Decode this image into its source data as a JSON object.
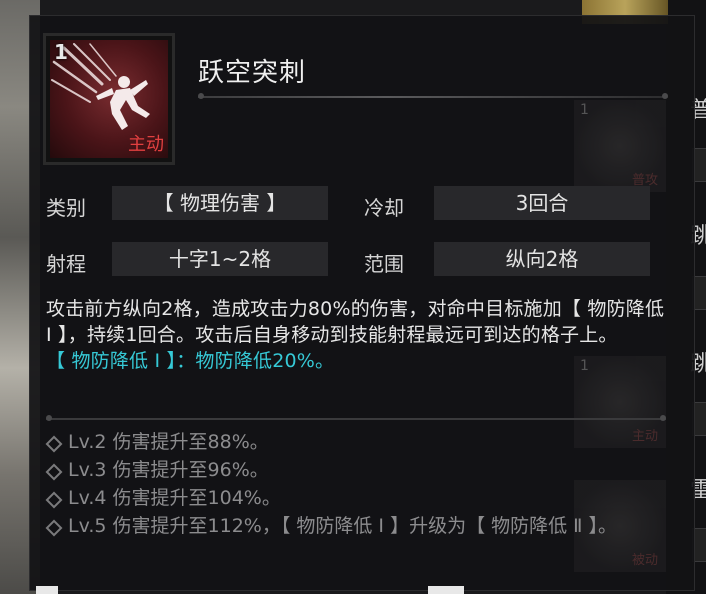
{
  "skill": {
    "level": "1",
    "type_badge": "主动",
    "name": "跃空突刺",
    "icon": "leaping-pierce-icon"
  },
  "attributes": [
    {
      "label": "类别",
      "value": "【 物理伤害 】"
    },
    {
      "label": "冷却",
      "value": "3回合"
    },
    {
      "label": "射程",
      "value": "十字1~2格"
    },
    {
      "label": "范围",
      "value": "纵向2格"
    }
  ],
  "description": {
    "main": "攻击前方纵向2格，造成攻击力80%的伤害，对命中目标施加【 物防降低 Ⅰ 】，持续1回合。攻击后自身移动到技能射程最远可到达的格子上。",
    "effect_note": "【 物防降低 Ⅰ 】：物防降低20%。"
  },
  "upgrades": [
    "Lv.2 伤害提升至88%。",
    "Lv.3 伤害提升至96%。",
    "Lv.4 伤害提升至104%。",
    "Lv.5 伤害提升至112%，【 物防降低 Ⅰ 】升级为【 物防降低 Ⅱ 】。"
  ],
  "background_cards": [
    {
      "level": "1",
      "label": "普攻"
    },
    {
      "level": "1",
      "label": "主动"
    },
    {
      "level": "",
      "label": "被动"
    }
  ],
  "side_tabs": [
    "普",
    "跳",
    "跳",
    "雷"
  ],
  "colors": {
    "highlight": "#36c9d6",
    "active_badge": "#e24040",
    "upgrade_text": "#8c8c8e"
  }
}
